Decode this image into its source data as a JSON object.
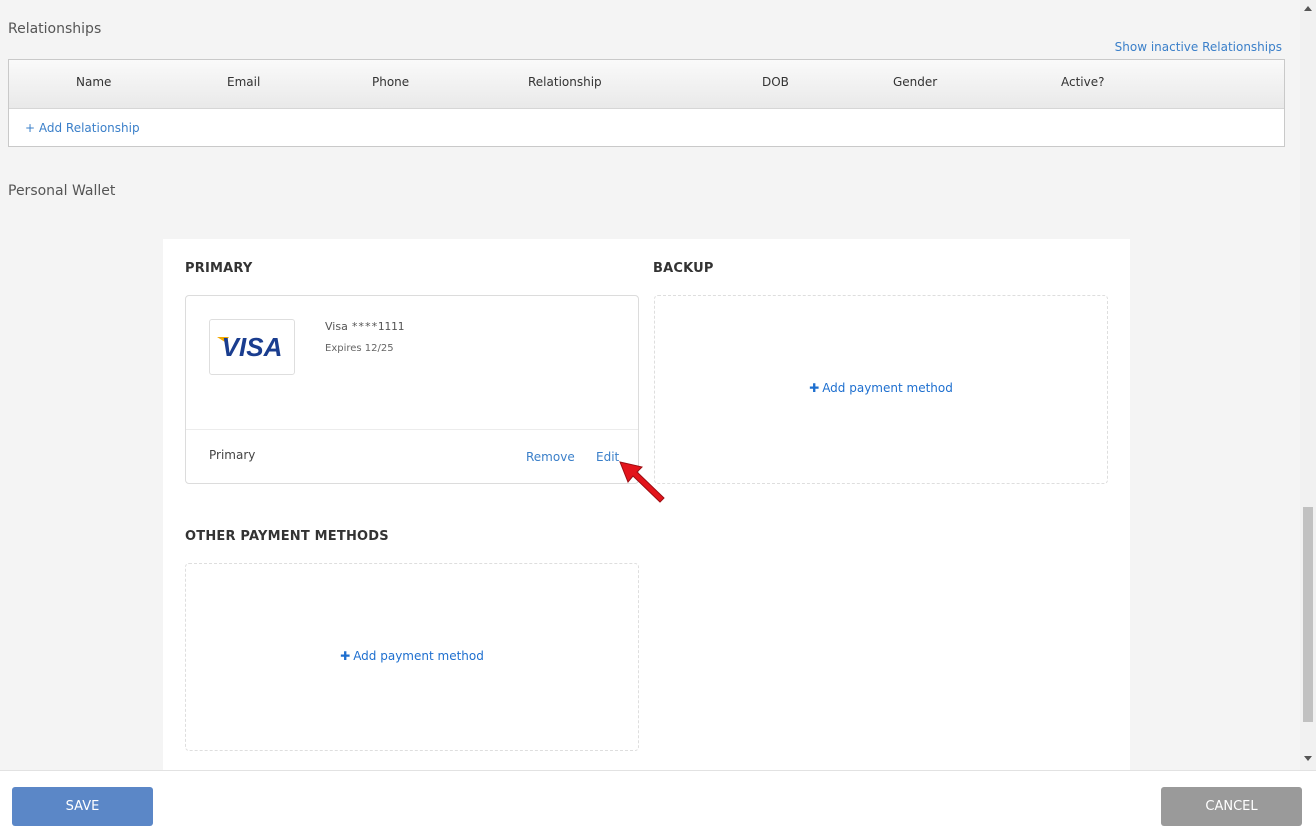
{
  "relationships": {
    "title": "Relationships",
    "show_inactive_link": "Show inactive Relationships",
    "columns": [
      "Name",
      "Email",
      "Phone",
      "Relationship",
      "DOB",
      "Gender",
      "Active?"
    ],
    "add_link": "+ Add Relationship"
  },
  "wallet": {
    "title": "Personal Wallet",
    "primary_label": "PRIMARY",
    "backup_label": "BACKUP",
    "other_label": "OTHER PAYMENT METHODS",
    "primary_card": {
      "brand": "VISA",
      "name_prefix": "Visa ",
      "masked_number": "****1111",
      "expires": "Expires 12/25",
      "role": "Primary",
      "remove_label": "Remove",
      "edit_label": "Edit"
    },
    "add_payment_label": "Add payment method"
  },
  "footer": {
    "save_label": "SAVE",
    "cancel_label": "CANCEL"
  },
  "colors": {
    "link": "#3a7fc9",
    "save_button": "#5b87c7",
    "cancel_button": "#9a9a9a",
    "annotation_arrow": "#e3141b"
  }
}
